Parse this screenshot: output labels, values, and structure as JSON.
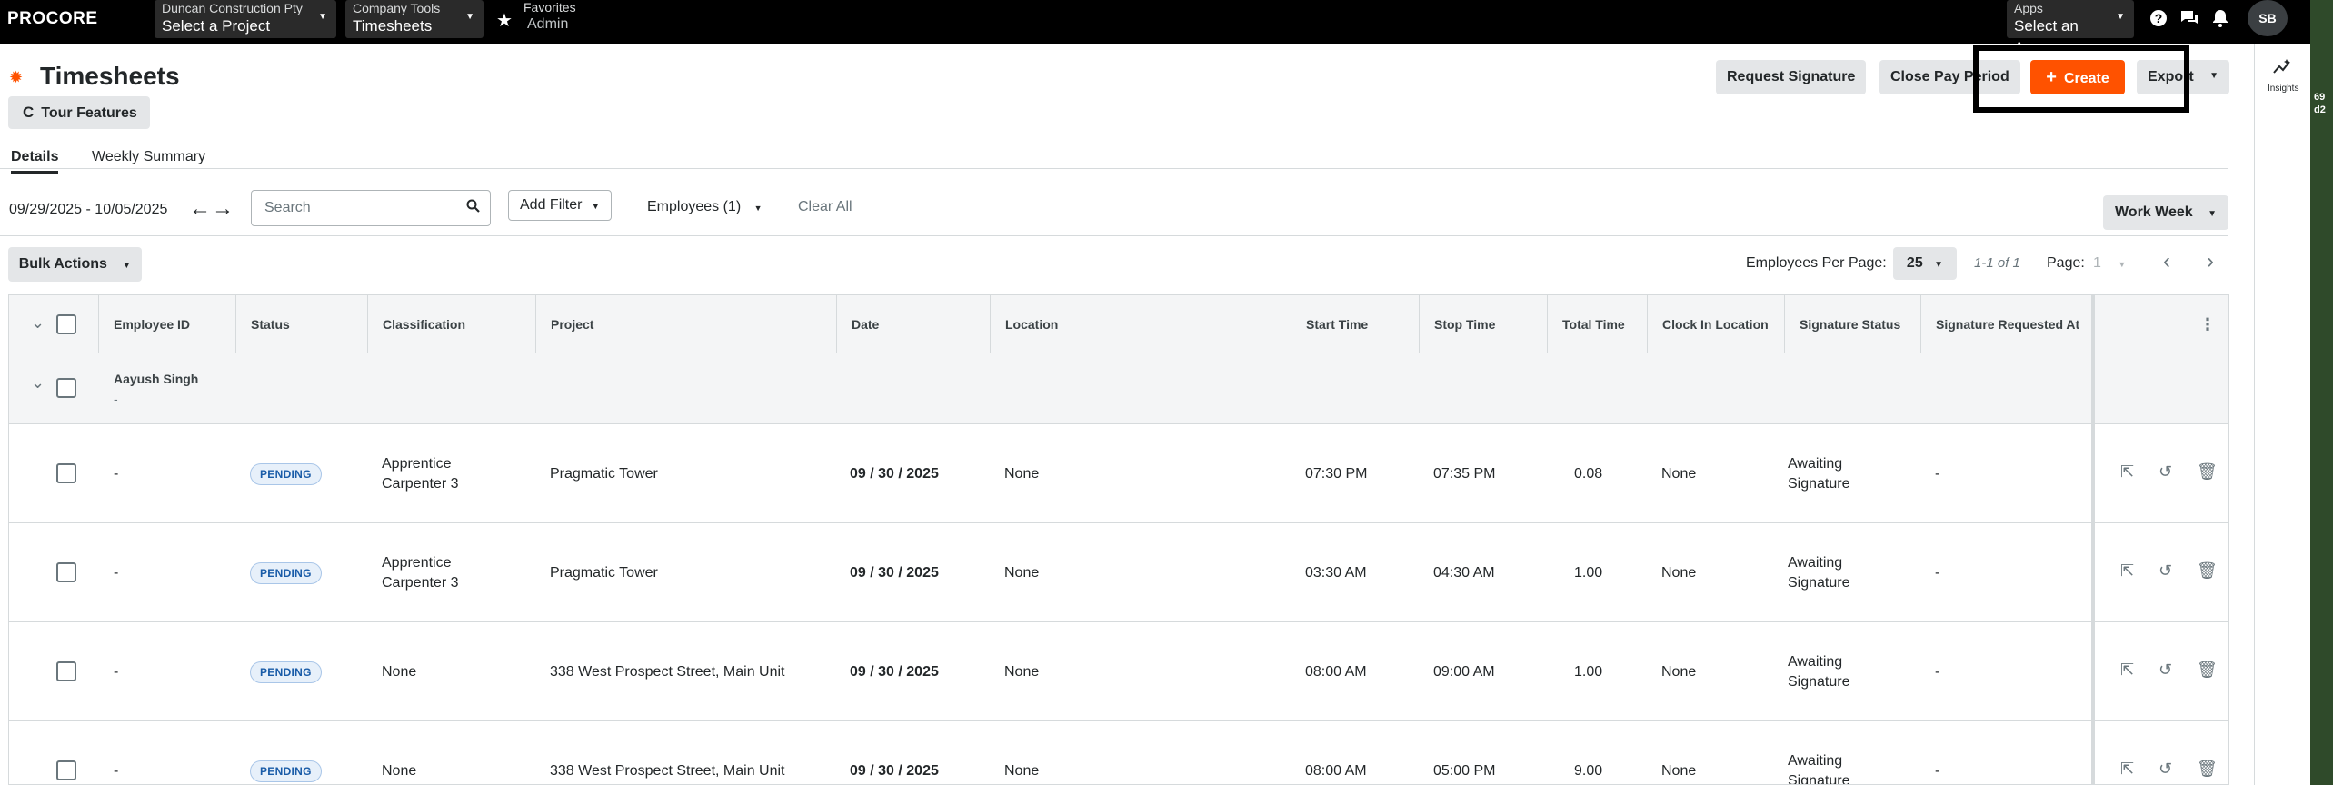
{
  "topbar": {
    "logo": "PROCORE",
    "project_selector": {
      "small": "Duncan Construction Pty",
      "value": "Select a Project"
    },
    "tool_selector": {
      "small": "Company Tools",
      "value": "Timesheets"
    },
    "favorites": {
      "small": "Favorites",
      "value": "Admin"
    },
    "apps": {
      "small": "Apps",
      "value": "Select an App"
    },
    "avatar_initials": "SB"
  },
  "header": {
    "title": "Timesheets",
    "tour_label": "Tour Features",
    "request_signature": "Request Signature",
    "close_pay_period": "Close Pay Period",
    "create": "Create",
    "export": "Export"
  },
  "tabs": [
    {
      "label": "Details",
      "active": true
    },
    {
      "label": "Weekly Summary",
      "active": false
    }
  ],
  "filters": {
    "date_range": "09/29/2025 - 10/05/2025",
    "search_placeholder": "Search",
    "add_filter": "Add Filter",
    "employees": "Employees (1)",
    "clear_all": "Clear All",
    "view": "Work Week"
  },
  "toolbar": {
    "bulk_actions": "Bulk Actions",
    "per_page_label": "Employees Per Page:",
    "per_page_value": "25",
    "range": "1-1 of 1",
    "page_label": "Page:",
    "page_value": "1"
  },
  "table": {
    "columns": [
      "Employee ID",
      "Status",
      "Classification",
      "Project",
      "Date",
      "Location",
      "Start Time",
      "Stop Time",
      "Total Time",
      "Clock In Location",
      "Signature Status",
      "Signature Requested At"
    ],
    "group": {
      "name": "Aayush Singh",
      "sub": "-"
    },
    "rows": [
      {
        "employee_id": "-",
        "status": "PENDING",
        "classification": "Apprentice Carpenter 3",
        "project": "Pragmatic Tower",
        "date": "09 / 30 / 2025",
        "location": "None",
        "start": "07:30 PM",
        "stop": "07:35 PM",
        "total": "0.08",
        "clock_in": "None",
        "signature": "Awaiting Signature",
        "requested_at": "-"
      },
      {
        "employee_id": "-",
        "status": "PENDING",
        "classification": "Apprentice Carpenter 3",
        "project": "Pragmatic Tower",
        "date": "09 / 30 / 2025",
        "location": "None",
        "start": "03:30 AM",
        "stop": "04:30 AM",
        "total": "1.00",
        "clock_in": "None",
        "signature": "Awaiting Signature",
        "requested_at": "-"
      },
      {
        "employee_id": "-",
        "status": "PENDING",
        "classification": "None",
        "project": "338 West Prospect Street, Main Unit",
        "date": "09 / 30 / 2025",
        "location": "None",
        "start": "08:00 AM",
        "stop": "09:00 AM",
        "total": "1.00",
        "clock_in": "None",
        "signature": "Awaiting Signature",
        "requested_at": "-"
      },
      {
        "employee_id": "-",
        "status": "PENDING",
        "classification": "None",
        "project": "338 West Prospect Street, Main Unit",
        "date": "09 / 30 / 2025",
        "location": "None",
        "start": "08:00 AM",
        "stop": "05:00 PM",
        "total": "9.00",
        "clock_in": "None",
        "signature": "Awaiting Signature",
        "requested_at": "-"
      }
    ]
  },
  "side_panel": {
    "insights_label": "Insights"
  },
  "edge_text": [
    "69",
    "d2"
  ],
  "colors": {
    "accent": "#ff5200",
    "topbar": "#000000",
    "badge_text": "#1a5ca8"
  }
}
